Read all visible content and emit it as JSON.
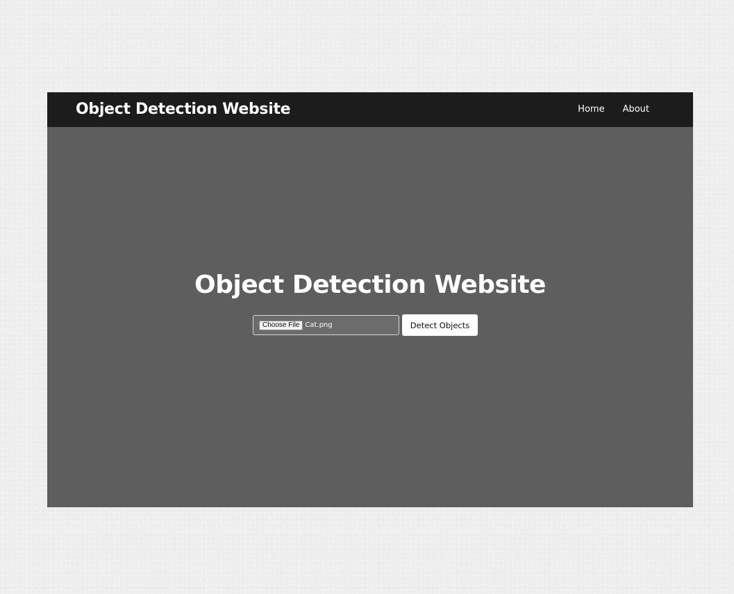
{
  "colors": {
    "page_background": "#eeeeee",
    "navbar_background": "#1c1c1c",
    "hero_background": "#5e5e5e",
    "text": "#ffffff",
    "button_background": "#ffffff"
  },
  "navbar": {
    "brand": "Object Detection Website",
    "links": [
      {
        "label": "Home"
      },
      {
        "label": "About"
      }
    ]
  },
  "hero": {
    "title": "Object Detection Website",
    "file_input": {
      "button_label": "Choose File",
      "file_name": "Cat.png"
    },
    "submit_label": "Detect Objects"
  }
}
